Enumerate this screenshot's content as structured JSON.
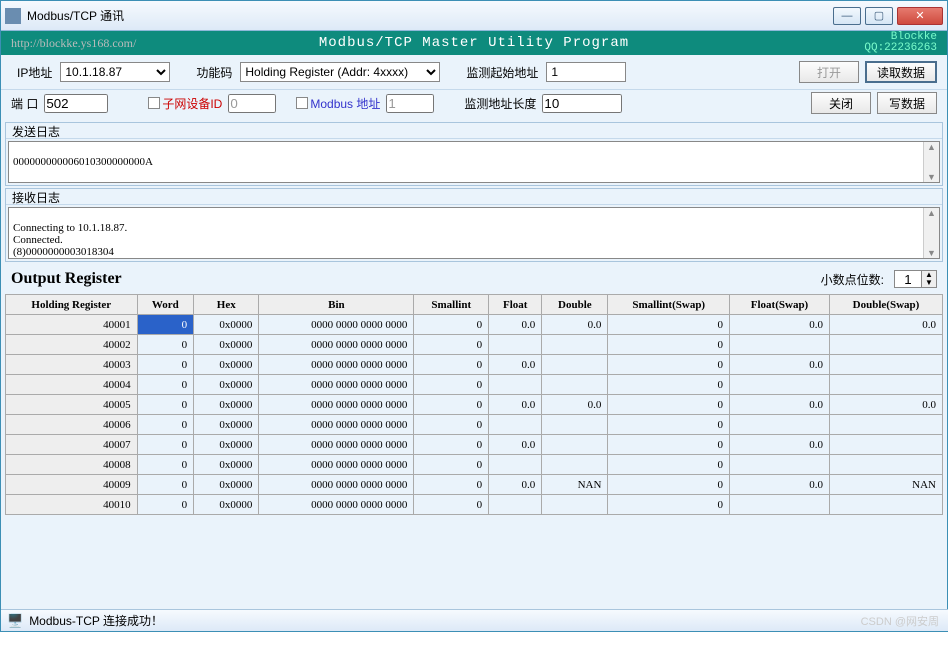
{
  "window": {
    "title": "Modbus/TCP 通讯"
  },
  "banner": {
    "url": "http://blockke.ys168.com/",
    "program_title": "Modbus/TCP  Master Utility Program",
    "author": "Blockke",
    "qq": "QQ:22236263"
  },
  "toolbar": {
    "ip_label": "IP地址",
    "ip_value": "10.1.18.87",
    "func_label": "功能码",
    "func_value": "Holding Register (Addr: 4xxxx)",
    "start_label": "监测起始地址",
    "start_value": "1",
    "len_label": "监测地址长度",
    "len_value": "10",
    "port_label": "端 口",
    "port_value": "502",
    "subnet_label": "子网设备ID",
    "subnet_value": "0",
    "modbus_addr_label": "Modbus 地址",
    "modbus_addr_value": "1",
    "btn_open": "打开",
    "btn_close": "关闭",
    "btn_read": "读取数据",
    "btn_write": "写数据"
  },
  "send_log": {
    "label": "发送日志",
    "text": "000000000006010300000000A"
  },
  "recv_log": {
    "label": "接收日志",
    "text": "Connecting to 10.1.18.87.\nConnected.\n(8)0000000003018304"
  },
  "output": {
    "title": "Output Register",
    "decimals_label": "小数点位数:",
    "decimals_value": "1",
    "columns": [
      "Holding Register",
      "Word",
      "Hex",
      "Bin",
      "Smallint",
      "Float",
      "Double",
      "Smallint(Swap)",
      "Float(Swap)",
      "Double(Swap)"
    ],
    "rows": [
      {
        "addr": "40001",
        "word": "0",
        "hex": "0x0000",
        "bin": "0000 0000 0000 0000",
        "si": "0",
        "f": "0.0",
        "d": "0.0",
        "sis": "0",
        "fs": "0.0",
        "ds": "0.0"
      },
      {
        "addr": "40002",
        "word": "0",
        "hex": "0x0000",
        "bin": "0000 0000 0000 0000",
        "si": "0",
        "f": "",
        "d": "",
        "sis": "0",
        "fs": "",
        "ds": ""
      },
      {
        "addr": "40003",
        "word": "0",
        "hex": "0x0000",
        "bin": "0000 0000 0000 0000",
        "si": "0",
        "f": "0.0",
        "d": "",
        "sis": "0",
        "fs": "0.0",
        "ds": ""
      },
      {
        "addr": "40004",
        "word": "0",
        "hex": "0x0000",
        "bin": "0000 0000 0000 0000",
        "si": "0",
        "f": "",
        "d": "",
        "sis": "0",
        "fs": "",
        "ds": ""
      },
      {
        "addr": "40005",
        "word": "0",
        "hex": "0x0000",
        "bin": "0000 0000 0000 0000",
        "si": "0",
        "f": "0.0",
        "d": "0.0",
        "sis": "0",
        "fs": "0.0",
        "ds": "0.0"
      },
      {
        "addr": "40006",
        "word": "0",
        "hex": "0x0000",
        "bin": "0000 0000 0000 0000",
        "si": "0",
        "f": "",
        "d": "",
        "sis": "0",
        "fs": "",
        "ds": ""
      },
      {
        "addr": "40007",
        "word": "0",
        "hex": "0x0000",
        "bin": "0000 0000 0000 0000",
        "si": "0",
        "f": "0.0",
        "d": "",
        "sis": "0",
        "fs": "0.0",
        "ds": ""
      },
      {
        "addr": "40008",
        "word": "0",
        "hex": "0x0000",
        "bin": "0000 0000 0000 0000",
        "si": "0",
        "f": "",
        "d": "",
        "sis": "0",
        "fs": "",
        "ds": ""
      },
      {
        "addr": "40009",
        "word": "0",
        "hex": "0x0000",
        "bin": "0000 0000 0000 0000",
        "si": "0",
        "f": "0.0",
        "d": "NAN",
        "sis": "0",
        "fs": "0.0",
        "ds": "NAN"
      },
      {
        "addr": "40010",
        "word": "0",
        "hex": "0x0000",
        "bin": "0000 0000 0000 0000",
        "si": "0",
        "f": "",
        "d": "",
        "sis": "0",
        "fs": "",
        "ds": ""
      }
    ]
  },
  "status": {
    "text": "Modbus-TCP 连接成功！"
  },
  "watermark": "CSDN @网安周"
}
